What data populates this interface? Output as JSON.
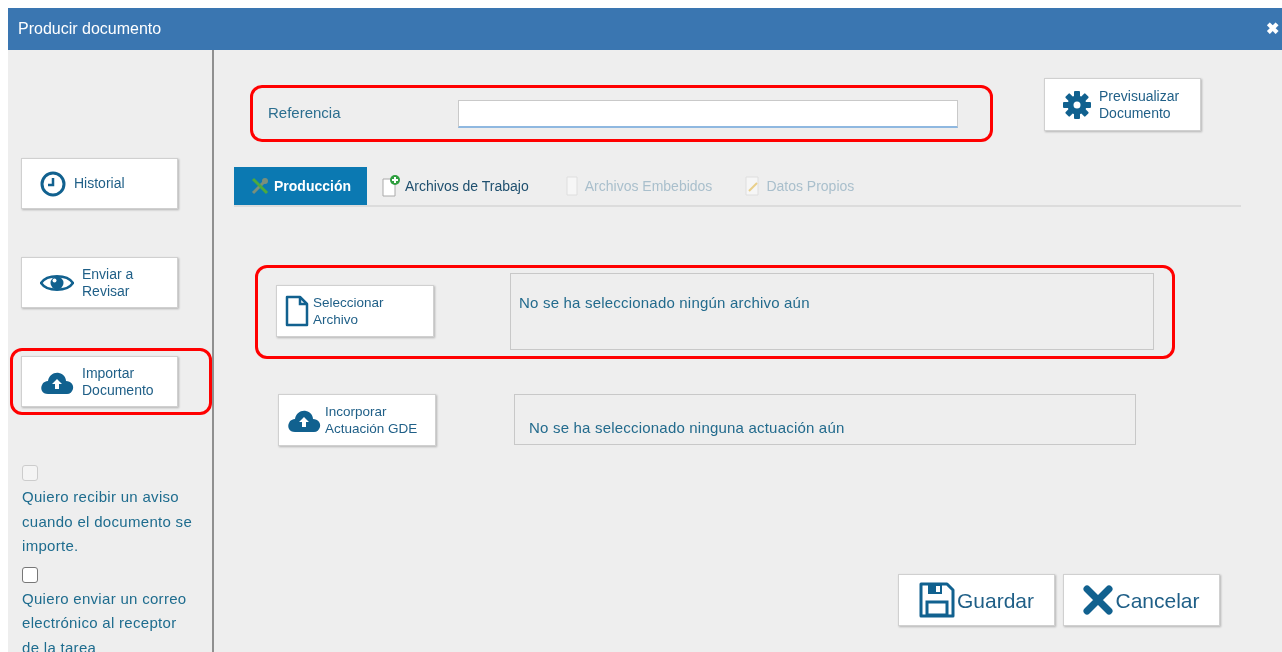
{
  "window": {
    "title": "Producir documento",
    "close": "✖"
  },
  "sidebar": {
    "buttons": [
      {
        "label": "Historial",
        "highlighted": false
      },
      {
        "label": "Enviar a\nRevisar",
        "highlighted": false
      },
      {
        "label": "Importar\nDocumento",
        "highlighted": true
      }
    ],
    "options": [
      {
        "label": "Quiero recibir un aviso cuando el documento se importe.",
        "checked": false,
        "disabled": true
      },
      {
        "label": "Quiero enviar un correo electrónico al receptor de la tarea",
        "checked": false,
        "disabled": false
      }
    ]
  },
  "reference": {
    "label": "Referencia",
    "highlighted": true
  },
  "preview_button": {
    "label": "Previsualizar\nDocumento"
  },
  "tabs": [
    {
      "label": "Producción",
      "selected": true,
      "disabled": false
    },
    {
      "label": "Archivos de Trabajo",
      "selected": false,
      "disabled": false
    },
    {
      "label": "Archivos Embebidos",
      "selected": false,
      "disabled": true
    },
    {
      "label": "Datos Propios",
      "selected": false,
      "disabled": true
    }
  ],
  "sections": [
    {
      "button": "Seleccionar\nArchivo",
      "status": "No se ha seleccionado ningún archivo aún",
      "highlighted": true
    },
    {
      "button": "Incorporar\nActuación GDE",
      "status": "No se ha seleccionado ninguna actuación aún",
      "highlighted": false
    }
  ],
  "actions": [
    {
      "label": "Guardar"
    },
    {
      "label": "Cancelar"
    }
  ]
}
